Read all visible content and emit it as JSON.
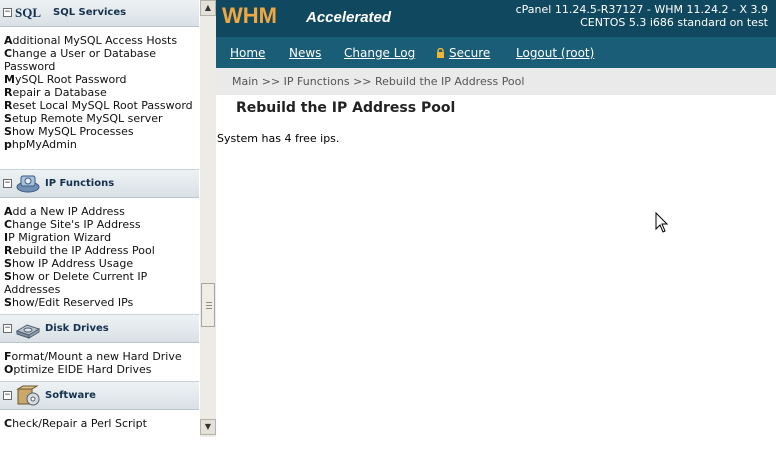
{
  "sidebar": {
    "sections": [
      {
        "title": "SQL Services",
        "logo_text": "SQL",
        "icon": "sql-icon",
        "links": [
          "Additional MySQL Access Hosts",
          "Change a User or Database Password",
          "MySQL Root Password",
          "Repair a Database",
          "Reset Local MySQL Root Password",
          "Setup Remote MySQL server",
          "Show MySQL Processes",
          "phpMyAdmin"
        ]
      },
      {
        "title": "IP Functions",
        "icon": "network-icon",
        "links": [
          "Add a New IP Address",
          "Change Site's IP Address",
          "IP Migration Wizard",
          "Rebuild the IP Address Pool",
          "Show IP Address Usage",
          "Show or Delete Current IP Addresses",
          "Show/Edit Reserved IPs"
        ]
      },
      {
        "title": "Disk Drives",
        "icon": "hard-drive-icon",
        "links": [
          "Format/Mount a new Hard Drive",
          "Optimize EIDE Hard Drives"
        ]
      },
      {
        "title": "Software",
        "icon": "software-box-icon",
        "links": [
          "Check/Repair a Perl Script"
        ]
      }
    ]
  },
  "header": {
    "logo_main": "WHM",
    "logo_sub": "Accelerated",
    "version_line1": "cPanel 11.24.5-R37127 - WHM 11.24.2 - X 3.9",
    "version_line2": "CENTOS 5.3 i686 standard on test"
  },
  "nav": {
    "items": [
      "Home",
      "News",
      "Change Log",
      "Secure",
      "Logout (root)"
    ],
    "secure_icon": "lock-icon"
  },
  "breadcrumb": "Main >> IP Functions >> Rebuild the IP Address Pool",
  "page": {
    "title": "Rebuild the IP Address Pool",
    "status": "System has 4 free ips."
  },
  "colors": {
    "header_bg": "#10495f",
    "nav_bg": "#1a5d76",
    "logo_orange": "#f2a640",
    "section_title": "#14314f"
  }
}
